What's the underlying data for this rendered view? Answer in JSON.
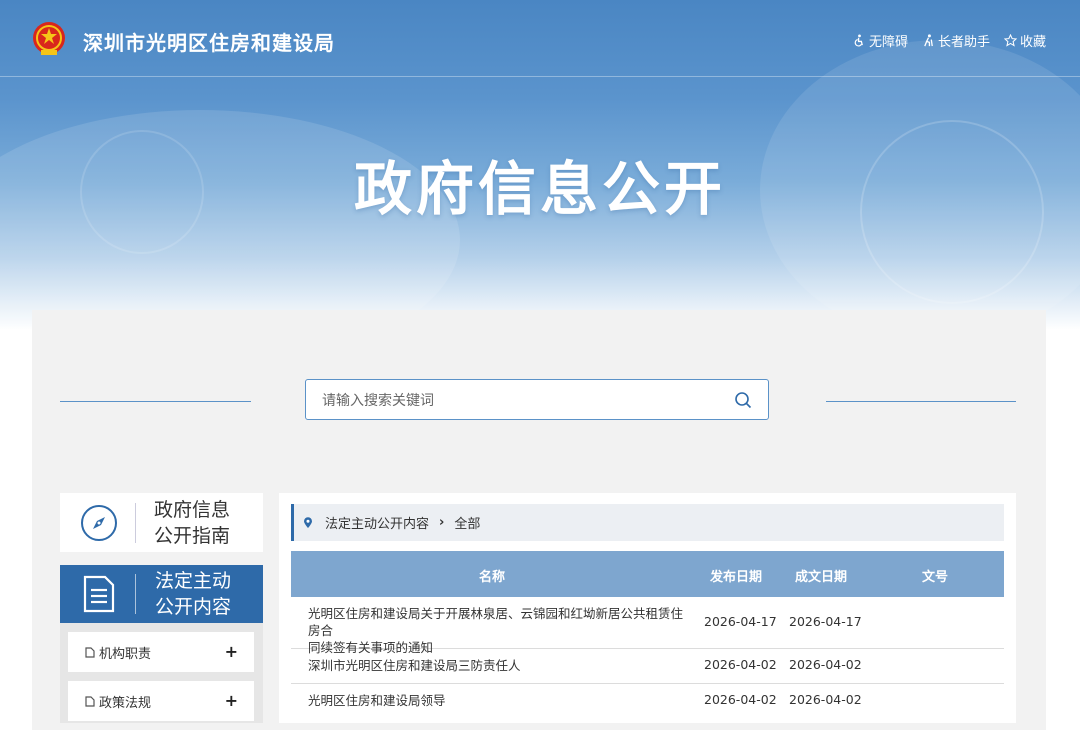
{
  "header": {
    "site_title": "深圳市光明区住房和建设局",
    "links": [
      {
        "label": "无障碍",
        "icon": "accessibility-icon"
      },
      {
        "label": "长者助手",
        "icon": "elder-helper-icon"
      },
      {
        "label": "收藏",
        "icon": "star-icon"
      }
    ]
  },
  "hero": {
    "title": "政府信息公开"
  },
  "search": {
    "placeholder": "请输入搜索关键词"
  },
  "sidebar": {
    "guide": {
      "line1": "政府信息",
      "line2": "公开指南"
    },
    "active": {
      "line1": "法定主动",
      "line2": "公开内容"
    },
    "items": [
      {
        "label": "机构职责"
      },
      {
        "label": "政策法规"
      }
    ]
  },
  "breadcrumb": {
    "section": "法定主动公开内容",
    "current": "全部"
  },
  "table": {
    "columns": [
      "名称",
      "发布日期",
      "成文日期",
      "文号"
    ],
    "rows": [
      {
        "name_line1": "光明区住房和建设局关于开展林泉居、云锦园和红坳新居公共租赁住房合",
        "name_line2": "同续签有关事项的通知",
        "publish": "2026-04-17",
        "written": "2026-04-17",
        "doc_no": ""
      },
      {
        "name_line1": "深圳市光明区住房和建设局三防责任人",
        "name_line2": "",
        "publish": "2026-04-02",
        "written": "2026-04-02",
        "doc_no": ""
      },
      {
        "name_line1": "光明区住房和建设局领导",
        "name_line2": "",
        "publish": "2026-04-02",
        "written": "2026-04-02",
        "doc_no": ""
      }
    ]
  },
  "colors": {
    "accent": "#2e6aa9",
    "table_header": "#7ea6cf",
    "banner": "#4a86c3"
  }
}
